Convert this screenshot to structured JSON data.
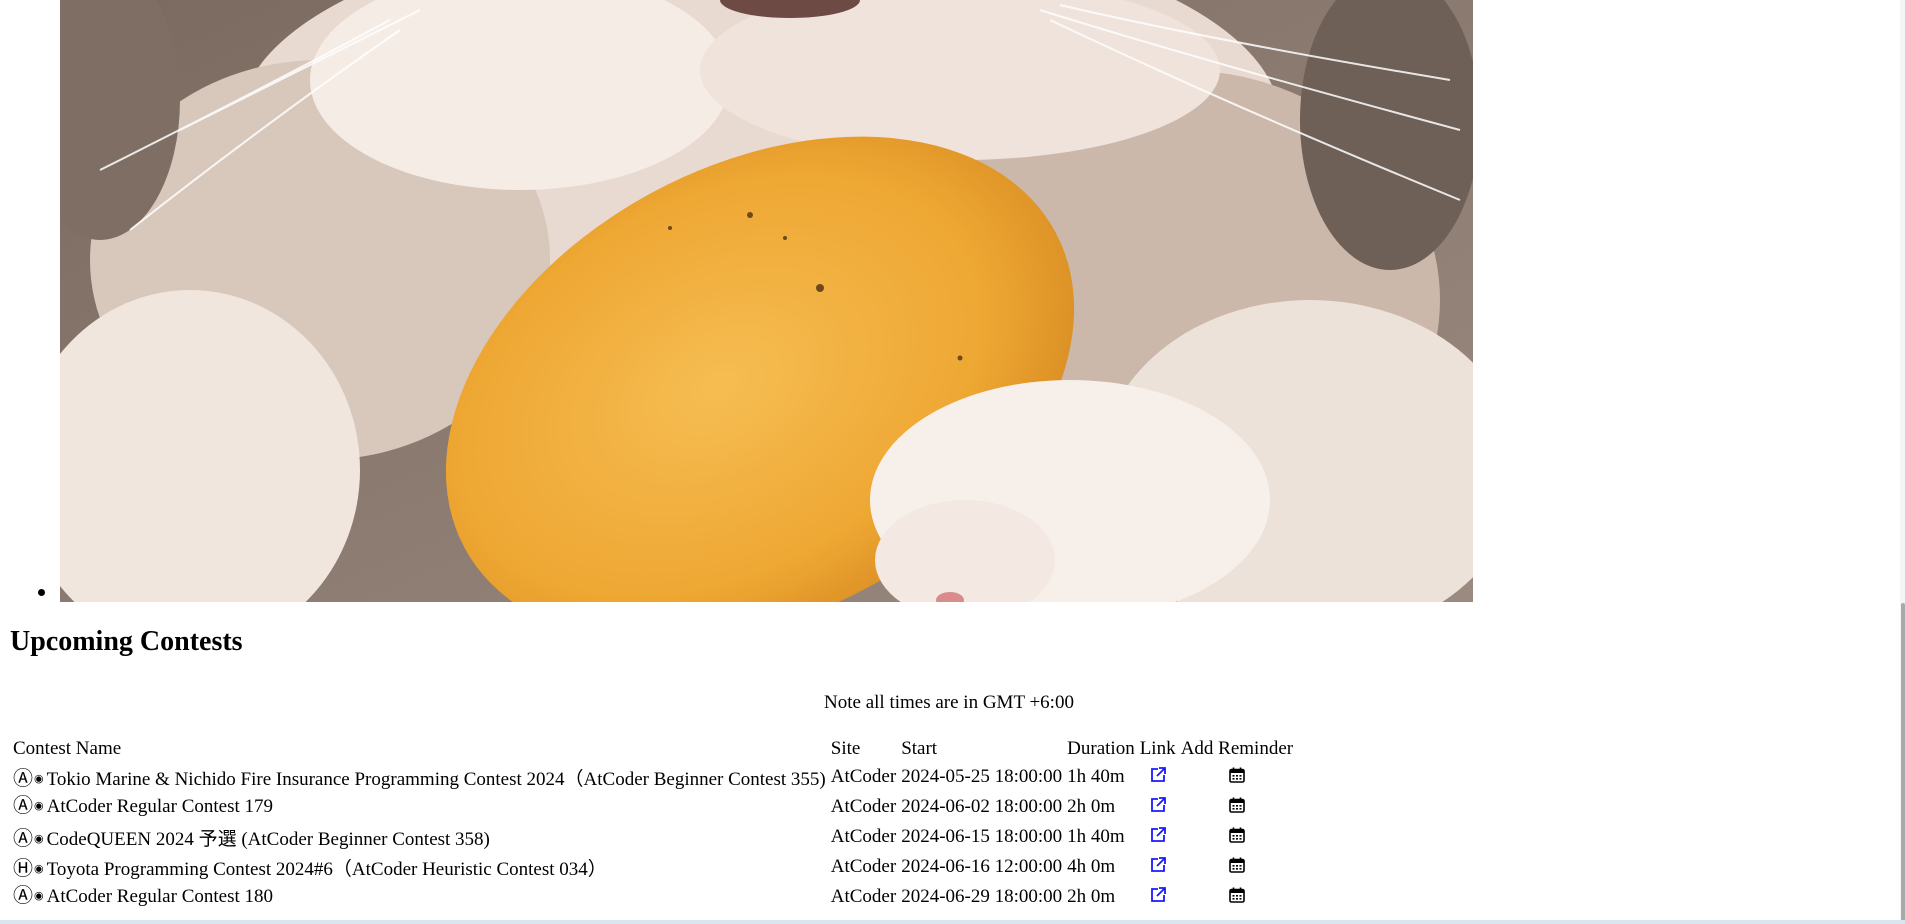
{
  "photo": {
    "alt": "cat holding a yellow mango"
  },
  "section": {
    "title": "Upcoming Contests",
    "note": "Note all times are in GMT +6:00"
  },
  "table": {
    "headers": {
      "name": "Contest Name",
      "site": "Site",
      "start": "Start",
      "duration": "Duration",
      "link": "Link",
      "reminder": "Add Reminder"
    },
    "rows": [
      {
        "icon": "Ⓐ",
        "icon_name": "atcoder-a-icon",
        "dot": "◉",
        "name": "Tokio Marine & Nichido Fire Insurance Programming Contest 2024（AtCoder Beginner Contest 355)",
        "site": "AtCoder",
        "start": "2024-05-25 18:00:00",
        "duration": "1h 40m"
      },
      {
        "icon": "Ⓐ",
        "icon_name": "atcoder-a-icon",
        "dot": "◉",
        "name": "AtCoder Regular Contest 179",
        "site": "AtCoder",
        "start": "2024-06-02 18:00:00",
        "duration": "2h 0m"
      },
      {
        "icon": "Ⓐ",
        "icon_name": "atcoder-a-icon",
        "dot": "◉",
        "name": "CodeQUEEN 2024 予選 (AtCoder Beginner Contest 358)",
        "site": "AtCoder",
        "start": "2024-06-15 18:00:00",
        "duration": "1h 40m"
      },
      {
        "icon": "Ⓗ",
        "icon_name": "atcoder-h-icon",
        "dot": "◉",
        "name": "Toyota Programming Contest 2024#6（AtCoder Heuristic Contest 034）",
        "site": "AtCoder",
        "start": "2024-06-16 12:00:00",
        "duration": "4h 0m"
      },
      {
        "icon": "Ⓐ",
        "icon_name": "atcoder-a-icon",
        "dot": "◉",
        "name": "AtCoder Regular Contest 180",
        "site": "AtCoder",
        "start": "2024-06-29 18:00:00",
        "duration": "2h 0m"
      }
    ]
  },
  "colors": {
    "link_icon": "#1a1aff",
    "calendar_icon": "#000000",
    "mango": "#f0ac3a",
    "fur_light": "#f3e8e0",
    "fur_dark": "#7c6b60"
  }
}
